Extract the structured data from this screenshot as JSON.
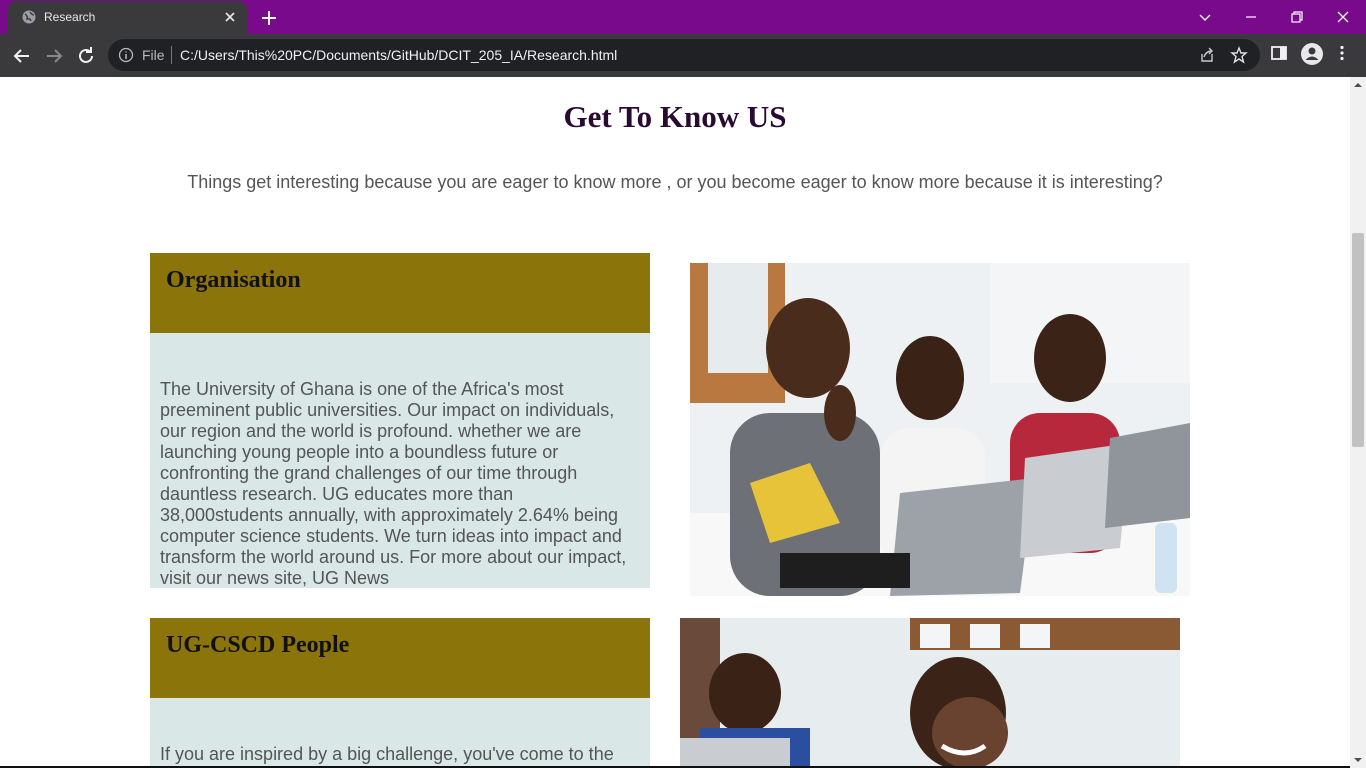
{
  "browser": {
    "tab_title": "Research",
    "omnibox_label": "File",
    "url": "C:/Users/This%20PC/Documents/GitHub/DCIT_205_IA/Research.html",
    "accent_color": "#7a0a8c"
  },
  "page": {
    "title": "Get To Know US",
    "subtitle": "Things get interesting because you are eager to know more , or you become eager to know more because it is interesting?",
    "sections": [
      {
        "heading": "Organisation",
        "body": "The University of Ghana is one of the Africa's most preeminent public universities. Our impact on individuals, our region and the world is profound. whether we are launching young people into a boundless future or confronting the grand challenges of our time through dauntless research. UG educates more than 38,000students annually, with approximately 2.64% being computer science students. We turn ideas into impact and transform the world around us. For more about our impact, visit our news site, UG News",
        "image": "students-with-laptops-photo"
      },
      {
        "heading": "UG-CSCD People",
        "body": "If you are inspired by a big challenge, you've come to the",
        "image": "smiling-student-photo"
      }
    ],
    "heading_color": "#8b7409",
    "body_bg_color": "#d9e7e7"
  }
}
